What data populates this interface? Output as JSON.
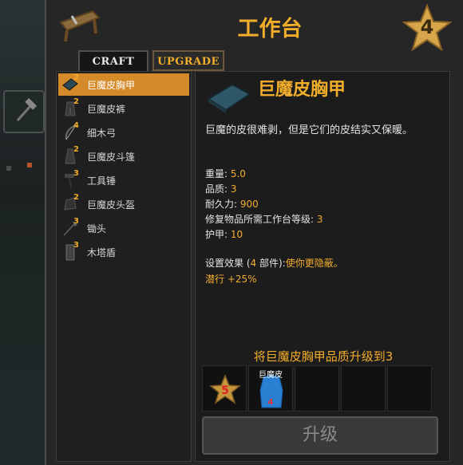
{
  "title": "工作台",
  "station_level": "4",
  "tabs": {
    "craft": "CRAFT",
    "upgrade": "UPGRADE"
  },
  "recipes": [
    {
      "quality": "2",
      "label": "巨魔皮胸甲",
      "selected": true,
      "icon": "chest-armor-icon"
    },
    {
      "quality": "2",
      "label": "巨魔皮裤",
      "icon": "leg-armor-icon"
    },
    {
      "quality": "4",
      "label": "细木弓",
      "icon": "bow-icon"
    },
    {
      "quality": "2",
      "label": "巨魔皮斗篷",
      "icon": "cape-icon"
    },
    {
      "quality": "3",
      "label": "工具锤",
      "icon": "hammer-icon"
    },
    {
      "quality": "2",
      "label": "巨魔皮头盔",
      "icon": "helmet-icon"
    },
    {
      "quality": "3",
      "label": "锄头",
      "icon": "hoe-icon"
    },
    {
      "quality": "3",
      "label": "木塔盾",
      "icon": "shield-icon"
    }
  ],
  "detail": {
    "name": "巨魔皮胸甲",
    "description": "巨魔的皮很难剥，但是它们的皮结实又保暖。",
    "stats": [
      {
        "label": "重量: ",
        "value": "5.0"
      },
      {
        "label": "品质: ",
        "value": "3"
      },
      {
        "label": "耐久力: ",
        "value": "900"
      },
      {
        "label": "修复物品所需工作台等级: ",
        "value": "3"
      },
      {
        "label": "护甲: ",
        "value": "10"
      }
    ],
    "set_effect": {
      "prefix": "设置效果 (",
      "count": "4",
      "middle": " 部件):",
      "effect": "使你更隐蔽。",
      "bonus": "潜行 +25%"
    }
  },
  "upgrade": {
    "title": "将巨魔皮胸甲品质升级到3",
    "station_star": "5",
    "material_name": "巨魔皮",
    "material_count": "4",
    "button": "升级"
  },
  "colors": {
    "accent": "#f2ad2b",
    "selected_row": "#d58a2a",
    "material": "#2a7fd0"
  }
}
